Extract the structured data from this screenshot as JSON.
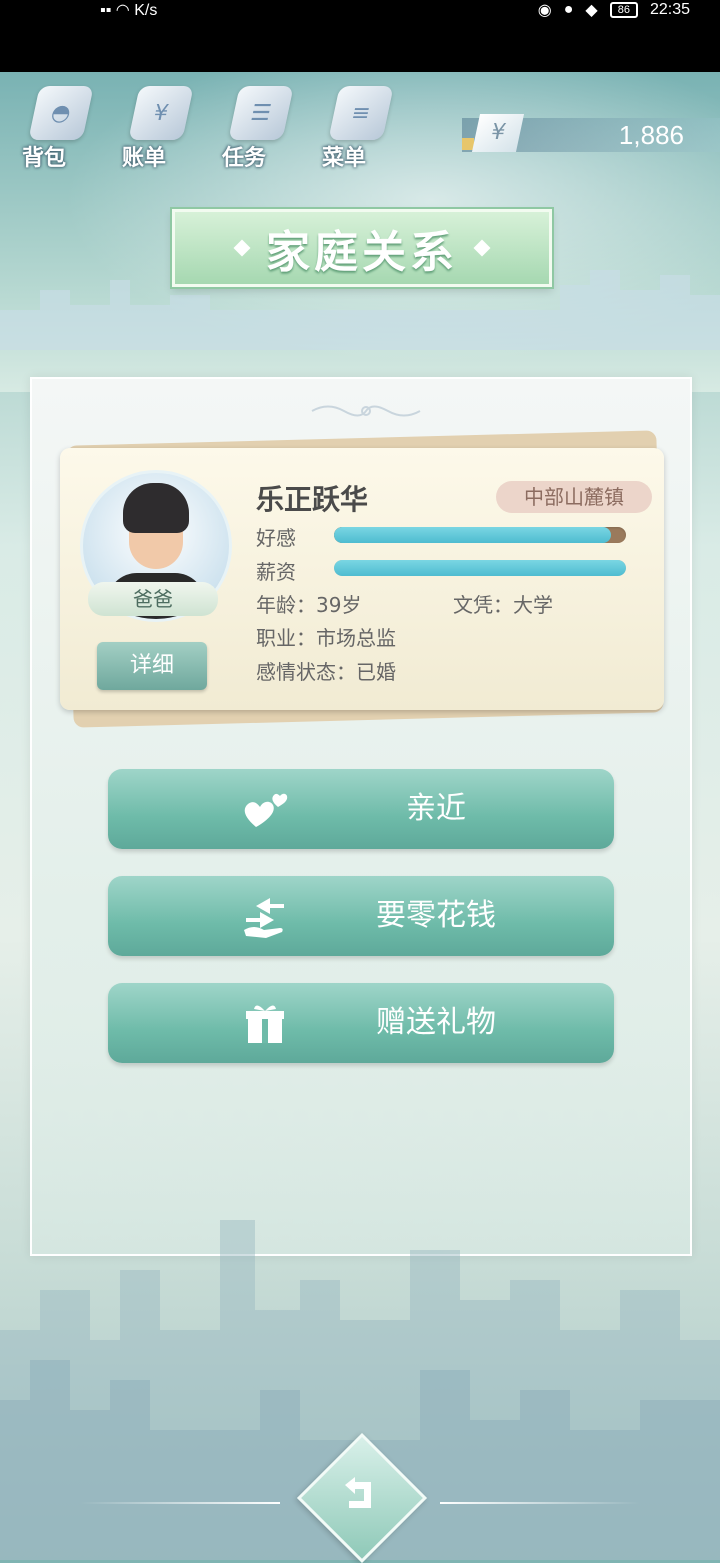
{
  "status_bar": {
    "network_speed": "K/s",
    "battery": "86",
    "time": "22:35"
  },
  "top_menu": [
    {
      "label": "背包",
      "icon": "bag-icon"
    },
    {
      "label": "账单",
      "icon": "bill-icon"
    },
    {
      "label": "任务",
      "icon": "task-icon"
    },
    {
      "label": "菜单",
      "icon": "menu-icon"
    }
  ],
  "currency": {
    "symbol": "¥",
    "amount": "1,886"
  },
  "page_title": "家庭关系",
  "member": {
    "name": "乐正跃华",
    "location": "中部山麓镇",
    "role": "爸爸",
    "favor_label": "好感",
    "favor_level": 0.95,
    "salary_label": "薪资",
    "salary_level": 1.0,
    "age": "年龄：39岁",
    "education": "文凭：大学",
    "job": "职业：市场总监",
    "relationship": "感情状态：已婚",
    "detail_label": "详细"
  },
  "actions": [
    {
      "label": "亲近",
      "icon": "hearts-icon"
    },
    {
      "label": "要零花钱",
      "icon": "exchange-icon"
    },
    {
      "label": "赠送礼物",
      "icon": "gift-icon"
    }
  ],
  "colors": {
    "accent": "#6ebba9",
    "bar": "#4ebcd0",
    "title": "#a6d8b1"
  }
}
